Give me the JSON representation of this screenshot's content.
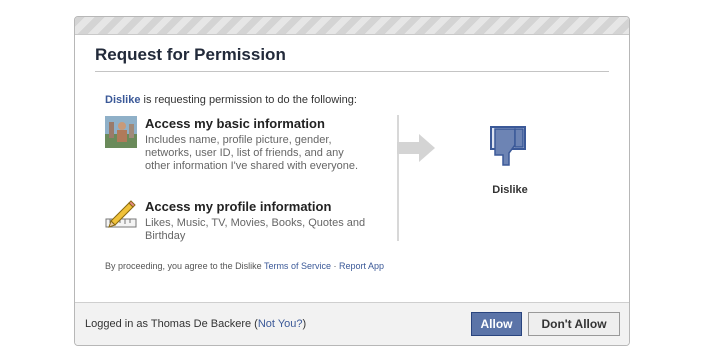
{
  "dialog": {
    "title": "Request for Permission",
    "intro_app": "Dislike",
    "intro_text": " is requesting permission to do the following:",
    "permissions": [
      {
        "title": "Access my basic information",
        "description": "Includes name, profile picture, gender, networks, user ID, list of friends, and any other information I've shared with everyone.",
        "icon": "profile-photo-icon"
      },
      {
        "title": "Access my profile information",
        "description": "Likes, Music, TV, Movies, Books, Quotes and Birthday",
        "icon": "pencil-ruler-icon"
      }
    ],
    "app": {
      "name": "Dislike",
      "icon": "thumbs-down-icon"
    },
    "legal": {
      "prefix": "By proceeding, you agree to the Dislike ",
      "terms_link": "Terms of Service",
      "separator": " · ",
      "report_link": "Report App"
    }
  },
  "footer": {
    "logged_prefix": "Logged in as Thomas De Backere (",
    "not_you_link": "Not You?",
    "logged_suffix": ")",
    "allow_label": "Allow",
    "deny_label": "Don't Allow"
  },
  "colors": {
    "link": "#3b5998",
    "allow_button": "#5b74a8"
  }
}
